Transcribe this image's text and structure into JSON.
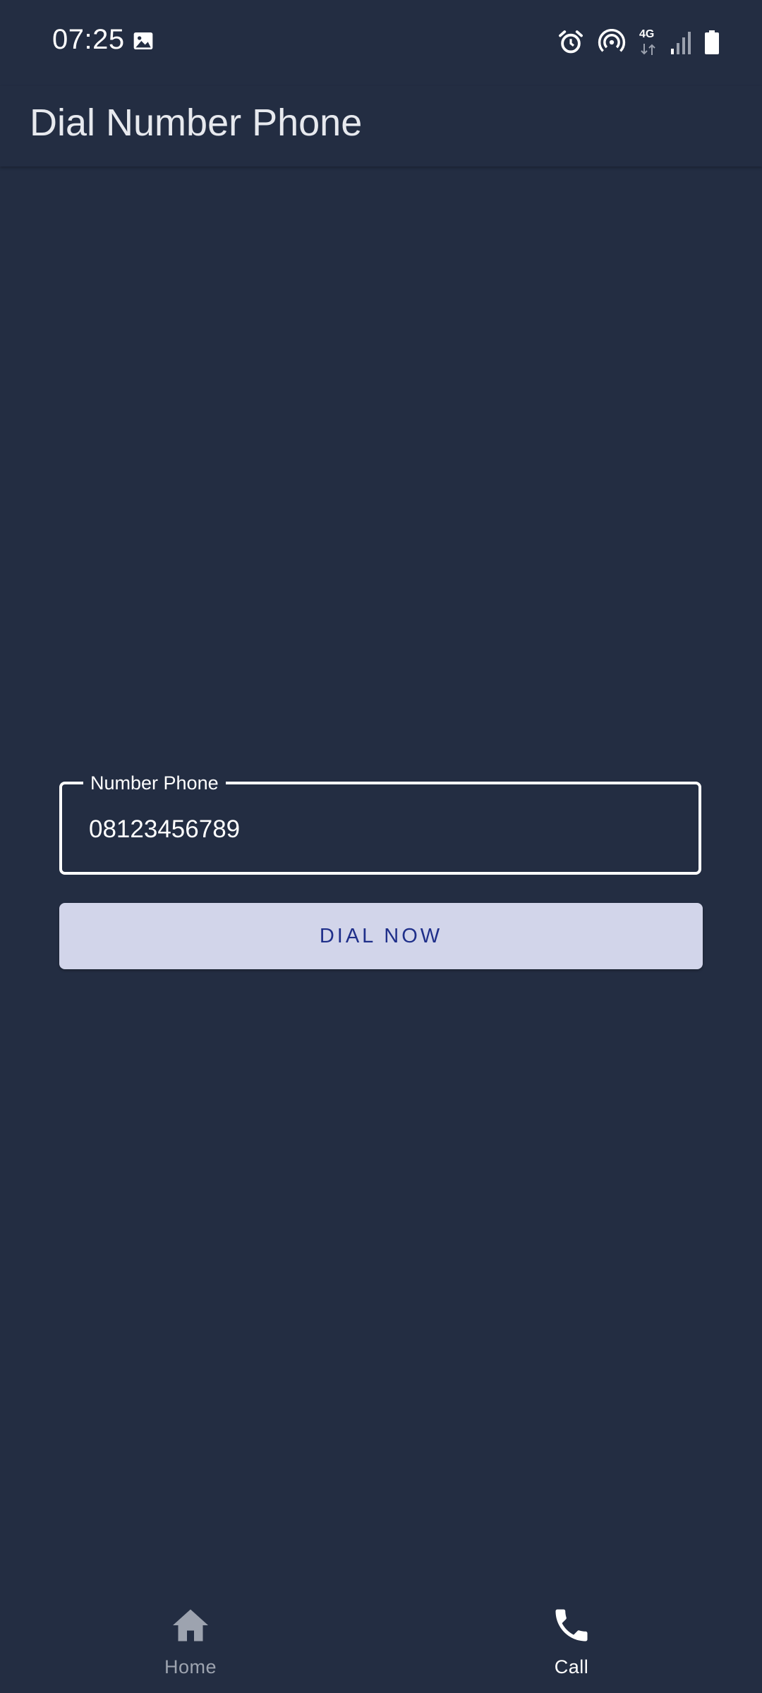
{
  "status_bar": {
    "time": "07:25",
    "network": "4G",
    "icons": [
      "gallery-icon",
      "alarm-icon",
      "hotspot-icon",
      "network-4g-icon",
      "signal-icon",
      "battery-icon"
    ]
  },
  "app_bar": {
    "title": "Dial Number Phone"
  },
  "form": {
    "phone_label": "Number Phone",
    "phone_value": "08123456789",
    "dial_button_label": "DIAL NOW"
  },
  "bottom_nav": {
    "items": [
      {
        "label": "Home",
        "icon": "home-icon",
        "selected": false
      },
      {
        "label": "Call",
        "icon": "phone-icon",
        "selected": true
      }
    ]
  },
  "colors": {
    "background": "#232d42",
    "button_background": "#d2d5ea",
    "button_text": "#1f2f8a",
    "inactive_nav": "#9da3af"
  }
}
